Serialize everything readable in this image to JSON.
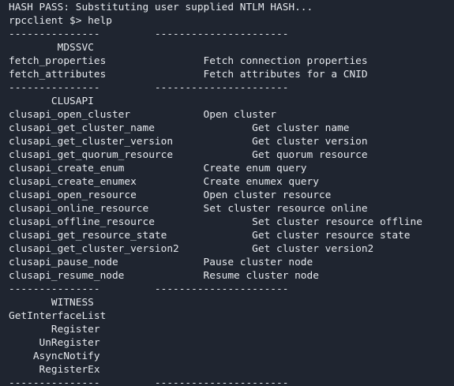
{
  "terminal": {
    "lines": [
      "HASH PASS: Substituting user supplied NTLM HASH...",
      "rpcclient $> help",
      "---------------         ----------------------",
      "        MDSSVC",
      "fetch_properties                Fetch connection properties",
      "fetch_attributes                Fetch attributes for a CNID",
      "---------------         ----------------------",
      "       CLUSAPI",
      "clusapi_open_cluster            Open cluster",
      "clusapi_get_cluster_name                Get cluster name",
      "clusapi_get_cluster_version             Get cluster version",
      "clusapi_get_quorum_resource             Get quorum resource",
      "clusapi_create_enum             Create enum query",
      "clusapi_create_enumex           Create enumex query",
      "clusapi_open_resource           Open cluster resource",
      "clusapi_online_resource         Set cluster resource online",
      "clusapi_offline_resource                Set cluster resource offline",
      "clusapi_get_resource_state              Get cluster resource state",
      "clusapi_get_cluster_version2            Get cluster version2",
      "clusapi_pause_node              Pause cluster node",
      "clusapi_resume_node             Resume cluster node",
      "---------------         ----------------------",
      "       WITNESS",
      "GetInterfaceList",
      "       Register",
      "     UnRegister",
      "    AsyncNotify",
      "     RegisterEx",
      "---------------         ----------------------"
    ]
  },
  "colors": {
    "background": "#1f2530",
    "text": "#e6e9ee"
  }
}
